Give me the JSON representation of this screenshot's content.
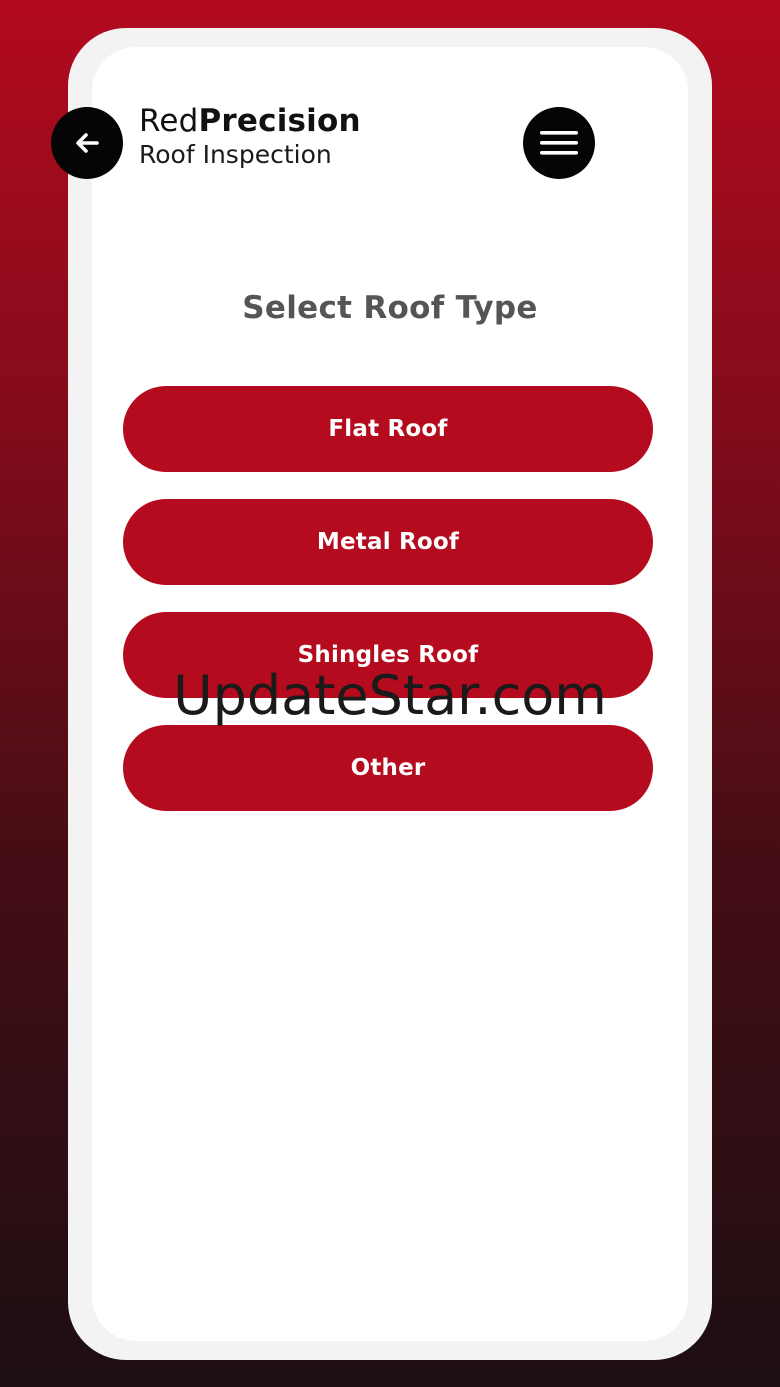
{
  "header": {
    "brand_primary": "Red",
    "brand_secondary": "Precision",
    "brand_subtitle": "Roof Inspection",
    "back_icon": "arrow-left-icon",
    "menu_icon": "hamburger-menu-icon"
  },
  "main": {
    "title": "Select Roof Type",
    "options": [
      {
        "label": "Flat Roof"
      },
      {
        "label": "Metal Roof"
      },
      {
        "label": "Shingles Roof"
      },
      {
        "label": "Other"
      }
    ]
  },
  "watermark": "UpdateStar.com",
  "colors": {
    "accent": "#b50b1e",
    "icon_button": "#050505",
    "title_text": "#555555"
  }
}
